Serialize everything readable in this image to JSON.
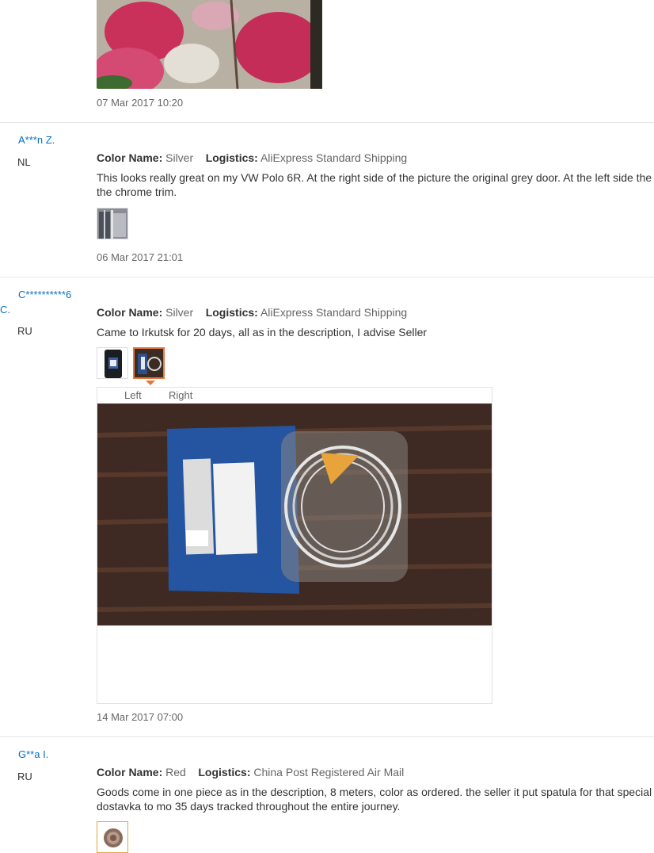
{
  "reviews": [
    {
      "date": "07 Mar 2017 10:20"
    },
    {
      "user": "A***n Z.",
      "country": "NL",
      "color_label": "Color Name:",
      "color_value": "Silver",
      "logistics_label": "Logistics:",
      "logistics_value": "AliExpress Standard Shipping",
      "text_line1": "This looks really great on my VW Polo 6R. At the right side of the picture the original grey door. At the left side the do",
      "text_line2": "the chrome trim.",
      "date": "06 Mar 2017 21:01"
    },
    {
      "user": "C**********6",
      "country": "RU",
      "color_label": "Color Name:",
      "color_value": "Silver",
      "logistics_label": "Logistics:",
      "logistics_value": "AliExpress Standard Shipping",
      "text_line1": "Came to Irkutsk for 20 days, all as in the description, I advise Seller",
      "viewer_left": "Left",
      "viewer_right": "Right",
      "date": "14 Mar 2017 07:00"
    },
    {
      "user": "G**a I.",
      "country": "RU",
      "color_label": "Color Name:",
      "color_value": "Red",
      "logistics_label": "Logistics:",
      "logistics_value": "China Post Registered Air Mail",
      "text_line1": "Goods come in one piece as in the description, 8 meters, color as ordered. the seller it put spatula for that special tha",
      "text_line2": "dostavka to mo 35 days tracked throughout the entire journey."
    }
  ],
  "edge_fragment": "C."
}
